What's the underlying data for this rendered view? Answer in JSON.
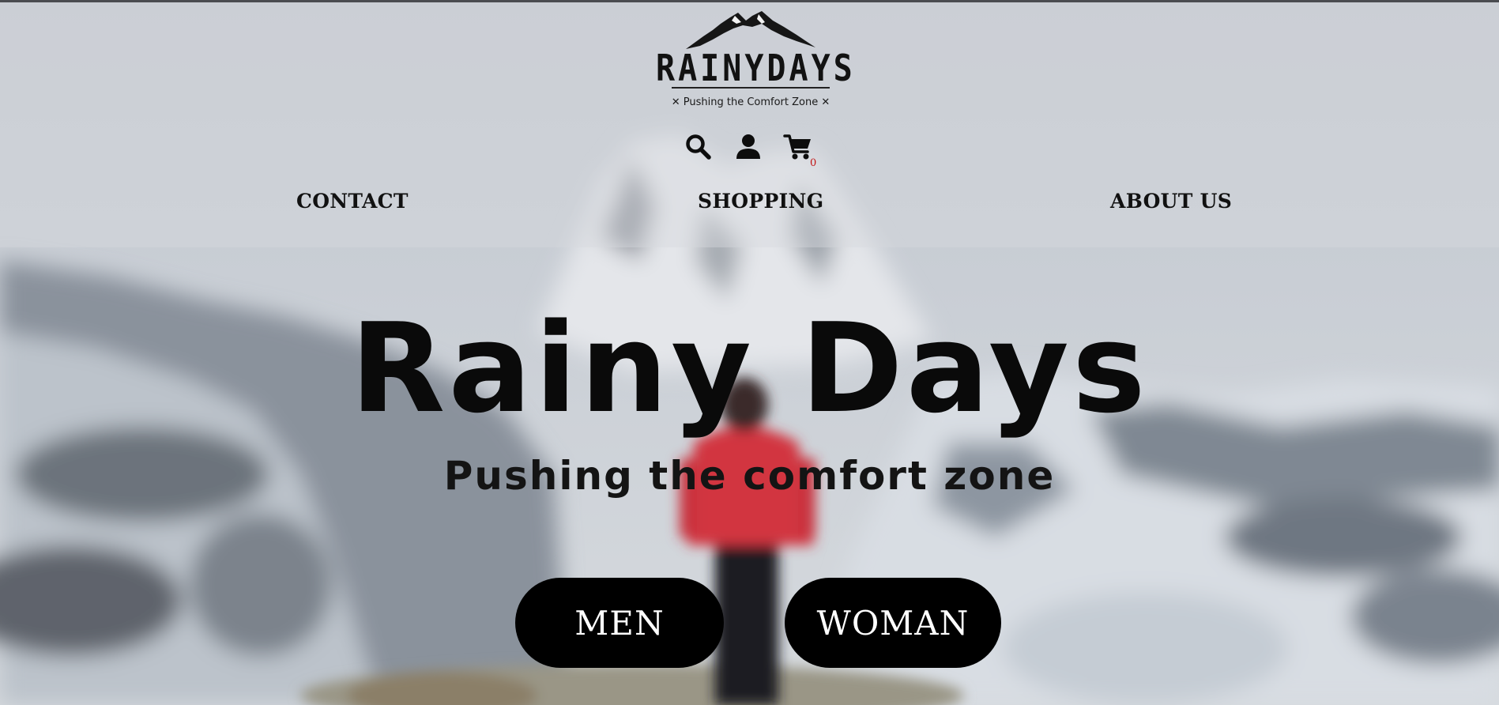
{
  "brand": {
    "logo_word": "RAINYDAYS",
    "logo_tagline": "✕ Pushing the Comfort Zone ✕",
    "text_color": "#111111",
    "cart_badge_color": "#c21515"
  },
  "header": {
    "icons": [
      "search-icon",
      "account-icon",
      "cart-icon"
    ],
    "cart_count": "0"
  },
  "nav": {
    "contact": "CONTACT",
    "shopping": "SHOPPING",
    "about": "ABOUT US"
  },
  "hero": {
    "title": "Rainy Days",
    "subtitle": "Pushing the comfort zone",
    "men_label": "MEN",
    "woman_label": "WOMAN",
    "button_color": "#000000",
    "background": "blurred snowy mountain with hiker in red jacket"
  }
}
